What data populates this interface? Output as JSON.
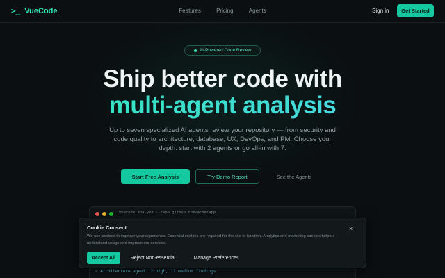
{
  "nav": {
    "logo_icon": ">_",
    "logo_text": "VueCode",
    "links": [
      "Features",
      "Pricing",
      "Agents"
    ],
    "sign_in": "Sign in",
    "get_started": "Get Started"
  },
  "hero": {
    "badge": "AI-Powered Code Review",
    "title_line1": "Ship better code with",
    "title_line2": "multi-agent analysis",
    "subtitle": "Up to seven specialized AI agents review your repository — from security and code quality to architecture, database, UX, DevOps, and PM. Choose your depth: start with 2 agents or go all-in with 7.",
    "cta_primary": "Start Free Analysis",
    "cta_secondary": "Try Demo Report",
    "cta_ghost": "See the Agents"
  },
  "terminal": {
    "command": "vuecode analyze --repo github.com/acme/app",
    "partial_line": "✓ Architecture agent: 2 high, 11 medium findings",
    "dot_colors": [
      "#ff5f56",
      "#ffbd2e",
      "#27c93f"
    ]
  },
  "cookie": {
    "title": "Cookie Consent",
    "text": "We use cookies to improve your experience. Essential cookies are required for the site to function. Analytics and marketing cookies help us understand usage and improve our services.",
    "accept": "Accept All",
    "reject": "Reject Non-essential",
    "manage": "Manage Preferences",
    "close": "×"
  },
  "colors": {
    "accent": "#14c9a0",
    "accent_text": "#2ee6b6",
    "background": "#0b0f11"
  }
}
